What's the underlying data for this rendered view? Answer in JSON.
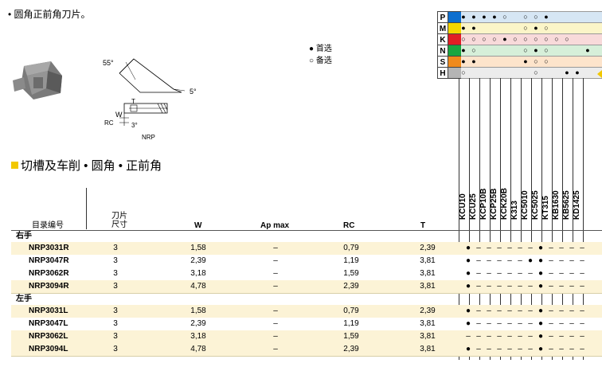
{
  "intro": "• 圆角正前角刀片。",
  "legend": {
    "preferred": "● 首选",
    "alternative": "○ 备选"
  },
  "drawing": {
    "angle_55": "55°",
    "angle_5": "5°",
    "label_T": "T",
    "label_W": "W",
    "label_RC": "RC",
    "angle_3": "3°",
    "model": "NRP"
  },
  "section_title": "切槽及车削 • 圆角 • 正前角",
  "materials": [
    {
      "key": "P",
      "color": "#0d6fcf",
      "band": "#d6e6f4",
      "marks": [
        "●",
        "●",
        "●",
        "●",
        "○",
        "",
        "○",
        "○",
        "●",
        "",
        "",
        "",
        ""
      ]
    },
    {
      "key": "M",
      "color": "#f3d600",
      "band": "#fbf5c8",
      "marks": [
        "●",
        "●",
        "",
        "",
        "",
        "",
        "○",
        "●",
        "○",
        "",
        "",
        "",
        ""
      ]
    },
    {
      "key": "K",
      "color": "#e11d24",
      "band": "#f8dada",
      "marks": [
        "○",
        "○",
        "○",
        "○",
        "●",
        "○",
        "○",
        "○",
        "○",
        "○",
        "○",
        "",
        ""
      ]
    },
    {
      "key": "N",
      "color": "#1aa640",
      "band": "#d6efd9",
      "marks": [
        "●",
        "○",
        "",
        "",
        "",
        "",
        "○",
        "●",
        "○",
        "",
        "",
        "",
        "●"
      ]
    },
    {
      "key": "S",
      "color": "#f08a1c",
      "band": "#fde4cb",
      "marks": [
        "●",
        "●",
        "",
        "",
        "",
        "",
        "●",
        "○",
        "○",
        "",
        "",
        "",
        ""
      ]
    },
    {
      "key": "H",
      "color": "#b4b4b4",
      "band": "#ececec",
      "marks": [
        "○",
        "",
        "",
        "",
        "",
        "",
        "",
        "○",
        "",
        "",
        "●",
        "●",
        ""
      ]
    }
  ],
  "grades": [
    "KCU10",
    "KCU25",
    "KCP10B",
    "KCP25B",
    "KCK20B",
    "K313",
    "KC5010",
    "KC5025",
    "KT315",
    "KB1630",
    "KB5625",
    "KD1425"
  ],
  "headers": {
    "catalog": "目录编号",
    "size_line1": "刀片",
    "size_line2": "尺寸",
    "w": "W",
    "ap": "Ap max",
    "rc": "RC",
    "t": "T"
  },
  "sections": [
    {
      "label": "右手",
      "rows": [
        {
          "cat": "NRP3031R",
          "size": "3",
          "w": "1,58",
          "ap": "–",
          "rc": "0,79",
          "t": "2,39",
          "g": [
            "●",
            "–",
            "–",
            "–",
            "–",
            "–",
            "–",
            "●",
            "–",
            "–",
            "–",
            "–"
          ]
        },
        {
          "cat": "NRP3047R",
          "size": "3",
          "w": "2,39",
          "ap": "–",
          "rc": "1,19",
          "t": "3,81",
          "g": [
            "●",
            "–",
            "–",
            "–",
            "–",
            "–",
            "●",
            "●",
            "–",
            "–",
            "–",
            "–"
          ]
        },
        {
          "cat": "NRP3062R",
          "size": "3",
          "w": "3,18",
          "ap": "–",
          "rc": "1,59",
          "t": "3,81",
          "g": [
            "●",
            "–",
            "–",
            "–",
            "–",
            "–",
            "–",
            "●",
            "–",
            "–",
            "–",
            "–"
          ]
        },
        {
          "cat": "NRP3094R",
          "size": "3",
          "w": "4,78",
          "ap": "–",
          "rc": "2,39",
          "t": "3,81",
          "g": [
            "●",
            "–",
            "–",
            "–",
            "–",
            "–",
            "–",
            "●",
            "–",
            "–",
            "–",
            "–"
          ]
        }
      ]
    },
    {
      "label": "左手",
      "rows": [
        {
          "cat": "NRP3031L",
          "size": "3",
          "w": "1,58",
          "ap": "–",
          "rc": "0,79",
          "t": "2,39",
          "g": [
            "●",
            "–",
            "–",
            "–",
            "–",
            "–",
            "–",
            "●",
            "–",
            "–",
            "–",
            "–"
          ]
        },
        {
          "cat": "NRP3047L",
          "size": "3",
          "w": "2,39",
          "ap": "–",
          "rc": "1,19",
          "t": "3,81",
          "g": [
            "●",
            "–",
            "–",
            "–",
            "–",
            "–",
            "–",
            "●",
            "–",
            "–",
            "–",
            "–"
          ]
        },
        {
          "cat": "NRP3062L",
          "size": "3",
          "w": "3,18",
          "ap": "–",
          "rc": "1,59",
          "t": "3,81",
          "g": [
            "–",
            "–",
            "–",
            "–",
            "–",
            "–",
            "–",
            "●",
            "–",
            "–",
            "–",
            "–"
          ]
        },
        {
          "cat": "NRP3094L",
          "size": "3",
          "w": "4,78",
          "ap": "–",
          "rc": "2,39",
          "t": "3,81",
          "g": [
            "●",
            "–",
            "–",
            "–",
            "–",
            "–",
            "–",
            "●",
            "–",
            "–",
            "–",
            "–"
          ]
        }
      ]
    }
  ]
}
